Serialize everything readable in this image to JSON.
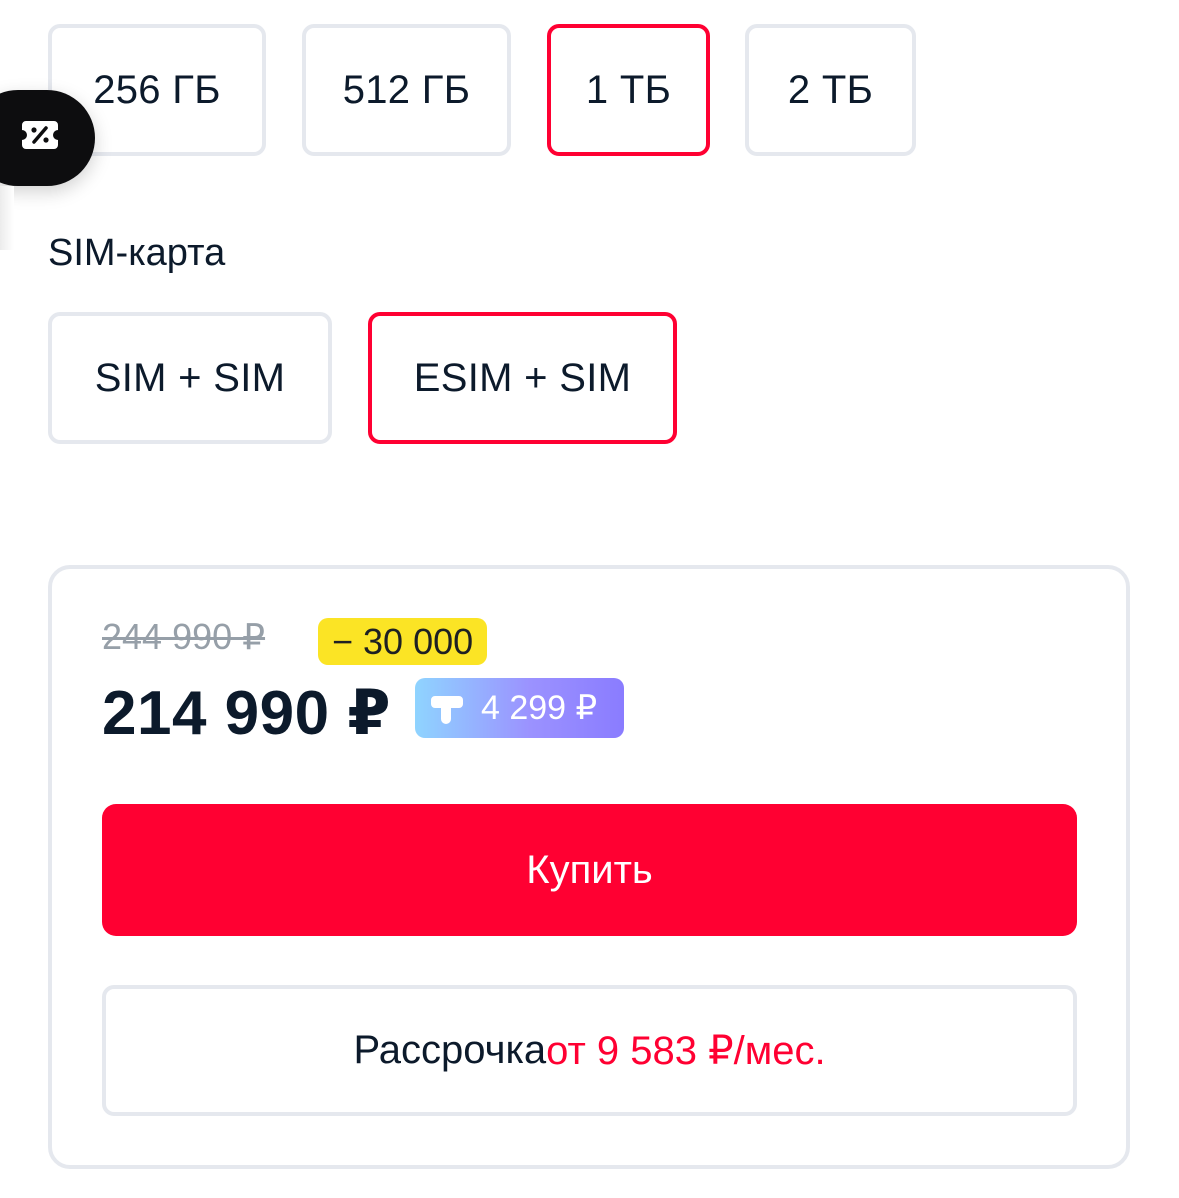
{
  "memory": {
    "options": [
      {
        "label": "256 ГБ",
        "selected": false
      },
      {
        "label": "512 ГБ",
        "selected": false
      },
      {
        "label": "1 ТБ",
        "selected": true
      },
      {
        "label": "2 ТБ",
        "selected": false
      }
    ]
  },
  "promo_button": {
    "icon": "discount-coupon-icon"
  },
  "sim": {
    "title": "SIM-карта",
    "options": [
      {
        "label": "SIM + SIM",
        "selected": false
      },
      {
        "label": "ESIM + SIM",
        "selected": true
      }
    ]
  },
  "price_card": {
    "old_price": "244 990 ₽",
    "discount": "− 30 000",
    "price": "214 990 ₽",
    "cashback": {
      "icon": "cashback-icon",
      "amount": "4 299 ₽"
    },
    "buy_label": "Купить",
    "installment": {
      "label": "Рассрочка",
      "amount": "от 9 583 ₽/мес."
    }
  },
  "colors": {
    "accent": "#ff0032",
    "text": "#0c1a2b",
    "border": "#e5e8ee",
    "discount_badge": "#fbe425"
  }
}
